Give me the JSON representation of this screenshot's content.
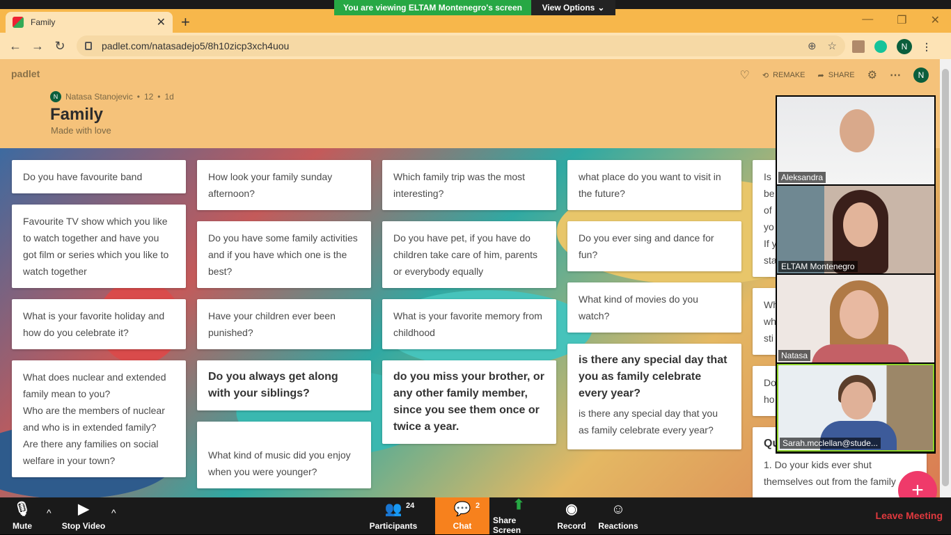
{
  "share": {
    "banner": "You are viewing ELTAM Montenegro's screen",
    "view_options": "View Options"
  },
  "browser": {
    "tab_title": "Family",
    "url": "padlet.com/natasadejo5/8h10zicp3xch4uou",
    "profile_initial": "N"
  },
  "padlet": {
    "logo": "padlet",
    "author": "Natasa Stanojevic",
    "separator": "•",
    "reactions": "12",
    "age": "1d",
    "title": "Family",
    "subtitle": "Made with love",
    "actions": {
      "remake": "REMAKE",
      "share": "SHARE"
    },
    "user_initial": "N"
  },
  "cards": [
    "Do you have favourite band",
    "Favourite TV show which you like to watch together and have you got film or series which you like to watch together",
    "What is your favorite holiday and how do you celebrate it?",
    "What does nuclear and extended family mean to you?\nWho are the members of nuclear and who is in extended family?\nAre there any families on social welfare in your town?",
    "How look your family sunday afternoon?",
    "Do you have some family activities and if you have which one is the best?",
    "Have your children ever been punished?",
    "Do you always get along with your siblings?",
    "What kind of music did you enjoy when you were younger?",
    "Which family trip was the most interesting?",
    "Do you have pet, if you have do children take care of him, parents or everybody equally",
    "What is your favorite memory from childhood",
    "do you miss your brother, or any other family member, since you see them once or twice a year.",
    "what place do you want to visit in the future?",
    "Do you ever sing and dance for fun?",
    "What kind of movies do you watch?",
    "is there any special day that you as family celebrate every year?",
    "is there any special day that you as family celebrate every year?",
    "Is\nbe\nof\nyo\nIf y\nsta",
    "Wh\nwh\nsti",
    "Do\nho",
    "Qu",
    "1. Do your kids ever shut themselves out from the family"
  ],
  "video": [
    {
      "name": "Aleksandra"
    },
    {
      "name": "ELTAM Montenegro"
    },
    {
      "name": "Natasa"
    },
    {
      "name": "Sarah.mcclellan@stude..."
    }
  ],
  "zoom": {
    "mute": "Mute",
    "stop_video": "Stop Video",
    "participants": "Participants",
    "participants_count": "24",
    "chat": "Chat",
    "chat_count": "2",
    "share_screen": "Share Screen",
    "record": "Record",
    "reactions": "Reactions",
    "leave": "Leave Meeting"
  },
  "colors": {
    "zoom_green": "#27a844",
    "chat_orange": "#f7811d",
    "leave_red": "#e0393e",
    "fab_pink": "#ef3a6a",
    "padlet_header": "#f5c27a"
  }
}
